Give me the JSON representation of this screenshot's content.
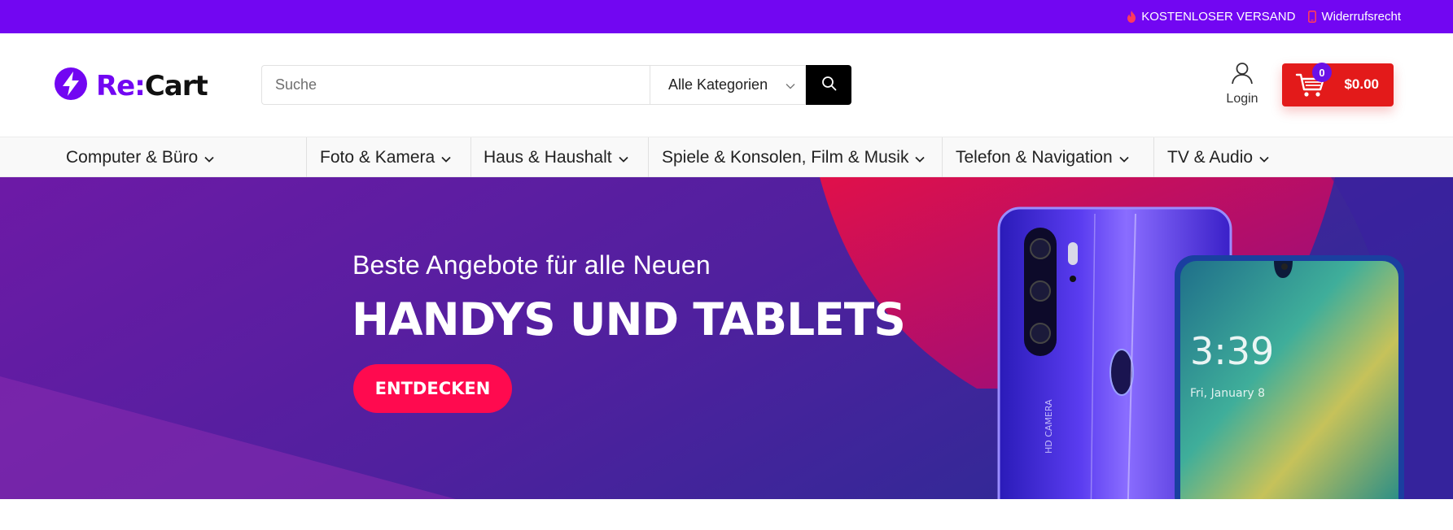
{
  "topbar": {
    "shipping_label": "KOSTENLOSER VERSAND",
    "revocation_label": "Widerrufsrecht"
  },
  "brand": {
    "name_prefix": "Re:",
    "name_suffix": "Cart"
  },
  "search": {
    "placeholder": "Suche",
    "value": "",
    "category": "Alle Kategorien"
  },
  "account": {
    "login_label": "Login"
  },
  "cart": {
    "count": "0",
    "total": "$0.00"
  },
  "nav": {
    "items": [
      {
        "label": "Computer & Büro"
      },
      {
        "label": "Foto & Kamera"
      },
      {
        "label": "Haus & Haushalt"
      },
      {
        "label": "Spiele & Konsolen, Film & Musik"
      },
      {
        "label": "Telefon & Navigation"
      },
      {
        "label": "TV & Audio"
      }
    ]
  },
  "hero": {
    "subtitle": "Beste Angebote für alle Neuen",
    "title": "HANDYS UND TABLETS",
    "cta_label": "ENTDECKEN",
    "phone_clock": "3:39",
    "phone_date": "Fri, January 8",
    "phone_back_text": "HD CAMERA"
  },
  "colors": {
    "brand_purple": "#7206f2",
    "cart_red": "#e31a1a",
    "cta_pink": "#ff0a4f",
    "hero_purple": "#5a1ea8"
  },
  "icons": {
    "shipping": "fire-icon",
    "revocation": "phone-icon",
    "logo": "lightning-bolt-icon",
    "search": "search-icon",
    "category_dropdown": "chevron-down-icon",
    "login": "user-icon",
    "cart": "cart-icon",
    "nav_item": "chevron-down-icon"
  }
}
